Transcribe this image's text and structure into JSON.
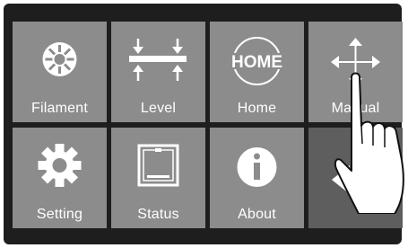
{
  "menu": {
    "items": [
      {
        "label": "Filament",
        "icon": "filament-icon"
      },
      {
        "label": "Level",
        "icon": "level-icon"
      },
      {
        "label": "Home",
        "icon": "home-icon",
        "icon_text": "HOME"
      },
      {
        "label": "Manual",
        "icon": "manual-move-icon"
      },
      {
        "label": "Setting",
        "icon": "gear-icon"
      },
      {
        "label": "Status",
        "icon": "status-printer-icon"
      },
      {
        "label": "About",
        "icon": "info-icon"
      }
    ],
    "back": {
      "icon": "back-arrow-icon"
    }
  },
  "overlay": {
    "icon": "pointing-hand-icon"
  },
  "colors": {
    "bezel": "#1e1e1e",
    "tile": "#8c8c8c",
    "back_tile": "#5e5e5e",
    "foreground": "#ffffff"
  }
}
